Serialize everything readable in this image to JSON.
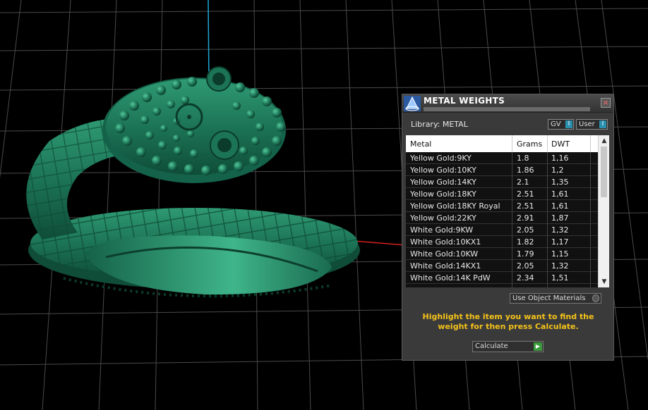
{
  "panel": {
    "title": "METAL WEIGHTS",
    "close_label": "×",
    "library_label": "Library: METAL",
    "toggles": {
      "gv_label": "GV",
      "user_label": "User",
      "indicator": "I"
    },
    "table": {
      "columns": [
        "Metal",
        "Grams",
        "DWT"
      ],
      "rows": [
        {
          "metal": "Yellow Gold:9KY",
          "grams": "1.8",
          "dwt": "1,16"
        },
        {
          "metal": "Yellow Gold:10KY",
          "grams": "1.86",
          "dwt": "1,2"
        },
        {
          "metal": "Yellow Gold:14KY",
          "grams": "2.1",
          "dwt": "1,35"
        },
        {
          "metal": "Yellow Gold:18KY",
          "grams": "2.51",
          "dwt": "1,61"
        },
        {
          "metal": "Yellow Gold:18KY Royal",
          "grams": "2.51",
          "dwt": "1,61"
        },
        {
          "metal": "Yellow Gold:22KY",
          "grams": "2.91",
          "dwt": "1,87"
        },
        {
          "metal": "White Gold:9KW",
          "grams": "2.05",
          "dwt": "1,32"
        },
        {
          "metal": "White Gold:10KX1",
          "grams": "1.82",
          "dwt": "1,17"
        },
        {
          "metal": "White Gold:10KW",
          "grams": "1.79",
          "dwt": "1,15"
        },
        {
          "metal": "White Gold:14KX1",
          "grams": "2.05",
          "dwt": "1,32"
        },
        {
          "metal": "White Gold:14K PdW",
          "grams": "2.34",
          "dwt": "1,51"
        }
      ]
    },
    "scroll_up": "▲",
    "scroll_down": "▼",
    "use_object_materials_label": "Use Object Materials",
    "hint_text": "Highlight the item you want to find the weight for then press Calculate.",
    "calculate_label": "Calculate",
    "calculate_go": "▶"
  },
  "colors": {
    "model_green": "#1f7a5c",
    "grid": "#4a4a4a",
    "axis_blue": "#1ea7d6",
    "axis_red": "#d52020",
    "hint_yellow": "#f4c21a"
  }
}
